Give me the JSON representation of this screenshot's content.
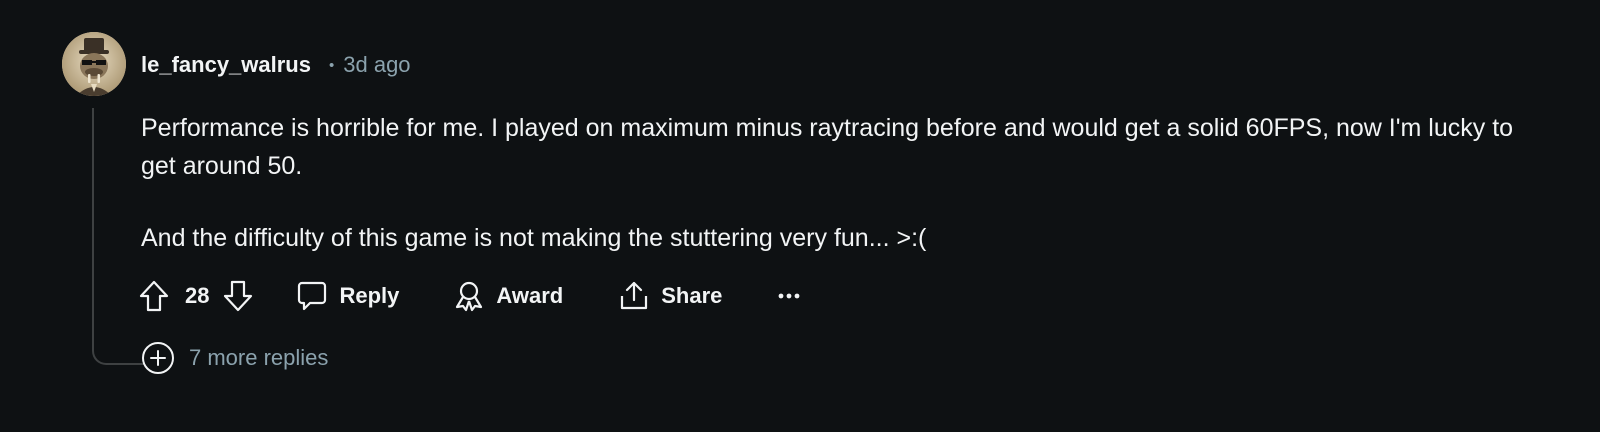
{
  "comment": {
    "author": "le_fancy_walrus",
    "separator": "•",
    "timestamp": "3d ago",
    "avatar_icon": "walrus-avatar-icon",
    "body": [
      "Performance is horrible for me. I played on maximum minus raytracing before and would get a solid 60FPS, now I'm lucky to get around 50.",
      "And the difficulty of this game is not making the stuttering very fun... >:("
    ],
    "score": "28",
    "actions": {
      "reply_label": "Reply",
      "award_label": "Award",
      "share_label": "Share",
      "more_label": "•••"
    },
    "more_replies_label": "7 more replies"
  },
  "colors": {
    "background": "#0e1113",
    "text": "#f2f4f5",
    "muted": "#8ba2ad",
    "thread_line": "#3e4142"
  }
}
